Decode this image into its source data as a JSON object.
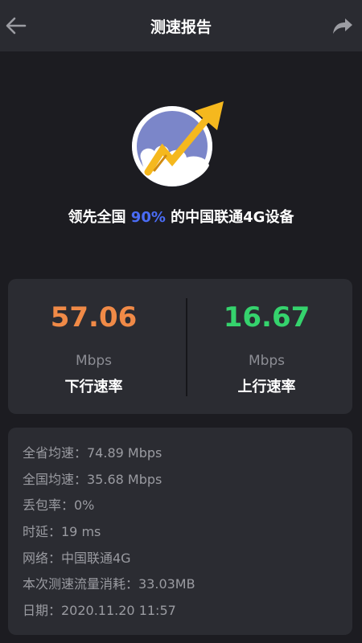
{
  "header": {
    "title": "测速报告",
    "back_icon": "arrow-left-icon",
    "share_icon": "share-arrow-icon"
  },
  "logo": {
    "icon": "rocket-arrow-cloud-logo",
    "colors": {
      "circle": "#7b86c9",
      "arrow": "#f5b81e",
      "cloud": "#ffffff"
    }
  },
  "headline": {
    "prefix": "领先全国 ",
    "percent": "90%",
    "suffix": " 的中国联通4G设备"
  },
  "download": {
    "value": "57.06",
    "unit": "Mbps",
    "label": "下行速率",
    "color": "#f08a47"
  },
  "upload": {
    "value": "16.67",
    "unit": "Mbps",
    "label": "上行速率",
    "color": "#35d36d"
  },
  "details": [
    "全省均速：74.89 Mbps",
    "全国均速：35.68 Mbps",
    "丢包率：0%",
    "时延：19 ms",
    "网络：中国联通4G",
    "本次测速流量消耗：33.03MB",
    "日期：2020.11.20  11:57"
  ],
  "theme": {
    "background": "#1c1c21",
    "card": "#2b2c32",
    "accent": "#4a6cf5"
  }
}
